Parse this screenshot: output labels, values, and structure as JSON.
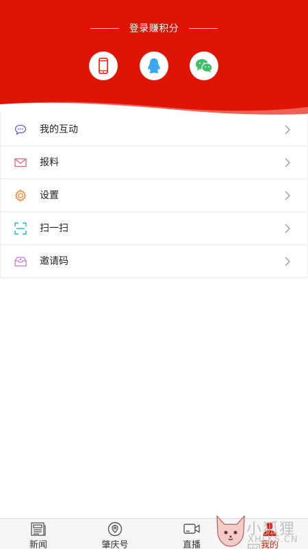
{
  "header": {
    "login_title": "登录赚积分",
    "login_options": [
      {
        "name": "phone-login",
        "icon": "phone-icon",
        "color": "#e01405"
      },
      {
        "name": "qq-login",
        "icon": "qq-penguin-icon",
        "color": "#3aa7f0"
      },
      {
        "name": "wechat-login",
        "icon": "wechat-icon",
        "color": "#3fbf6a"
      }
    ],
    "background_color": "#e01405"
  },
  "menu": {
    "items": [
      {
        "label": "我的互动",
        "icon": "chat-bubble-icon",
        "icon_color": "#6a5acd"
      },
      {
        "label": "报料",
        "icon": "envelope-icon",
        "icon_color": "#e8667a"
      },
      {
        "label": "设置",
        "icon": "gear-icon",
        "icon_color": "#f08a3c"
      },
      {
        "label": "扫一扫",
        "icon": "scan-icon",
        "icon_color": "#22b0d0"
      },
      {
        "label": "邀请码",
        "icon": "invite-inbox-icon",
        "icon_color": "#c27ad6"
      }
    ]
  },
  "tabbar": {
    "tabs": [
      {
        "label": "新闻",
        "icon": "newspaper-icon",
        "active": false
      },
      {
        "label": "肇庆号",
        "icon": "location-pin-icon",
        "active": false
      },
      {
        "label": "直播",
        "icon": "video-camera-icon",
        "active": false
      },
      {
        "label": "我的",
        "icon": "person-icon",
        "active": true
      }
    ],
    "active_color": "#e01405"
  },
  "watermark": {
    "text": "小狐狸网",
    "sub": "XHLKS.CN"
  }
}
